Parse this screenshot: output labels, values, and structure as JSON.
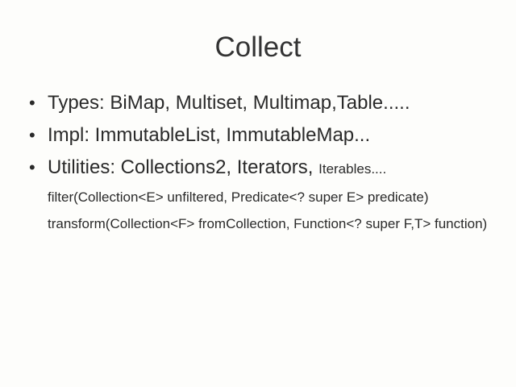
{
  "slide": {
    "title": "Collect",
    "bullets": [
      {
        "text": "Types: BiMap, Multiset, Multimap,Table....."
      },
      {
        "text": "Impl: ImmutableList, ImmutableMap..."
      },
      {
        "text": "Utilities: Collections2, Iterators, ",
        "small": "Iterables...."
      }
    ],
    "bullet_symbol": "•",
    "sub_lines": [
      "filter(Collection<E> unfiltered, Predicate<? super E> predicate)",
      "transform(Collection<F> fromCollection, Function<? super F,T> function)"
    ]
  }
}
